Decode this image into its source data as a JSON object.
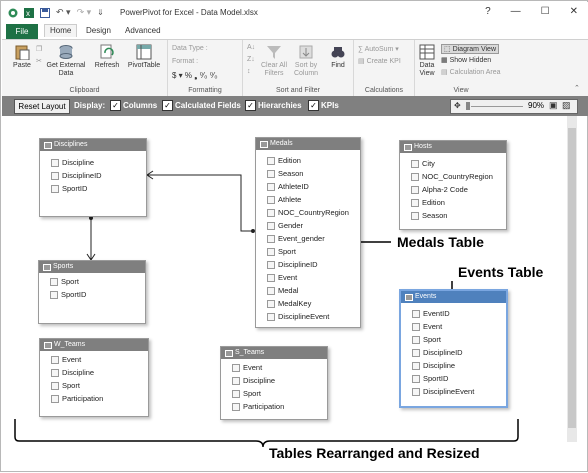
{
  "window": {
    "title": "PowerPivot for Excel - Data Model.xlsx",
    "buttons": [
      "?",
      "—",
      "☐",
      "✕"
    ]
  },
  "tabs": [
    "File",
    "Home",
    "Design",
    "Advanced"
  ],
  "ribbon": {
    "paste": "Paste",
    "get_external": "Get External Data",
    "refresh": "Refresh",
    "pivottable": "PivotTable",
    "data_type": "Data Type :",
    "format": "Format :",
    "currency_row": "$ ▾ % ❟ ⁰⁄₀ ⁰⁄₀",
    "clear_filters": "Clear All Filters",
    "sort_by": "Sort by Column",
    "find": "Find",
    "autosum": "AutoSum ▾",
    "create_kpi": "Create KPI",
    "data_view": "Data View",
    "diagram_view": "Diagram View",
    "show_hidden": "Show Hidden",
    "calc_area": "Calculation Area",
    "groups": [
      "Clipboard",
      "Formatting",
      "Sort and Filter",
      "Calculations",
      "View"
    ]
  },
  "toolbar": {
    "reset": "Reset Layout",
    "display": "Display:",
    "options": [
      "Columns",
      "Calculated Fields",
      "Hierarchies",
      "KPIs"
    ],
    "zoom": "90%"
  },
  "tables": {
    "disciplines": {
      "name": "Disciplines",
      "columns": [
        "Discipline",
        "DisciplineID",
        "SportID"
      ]
    },
    "medals": {
      "name": "Medals",
      "columns": [
        "Edition",
        "Season",
        "AthleteID",
        "Athlete",
        "NOC_CountryRegion",
        "Gender",
        "Event_gender",
        "Sport",
        "DisciplineID",
        "Event",
        "Medal",
        "MedalKey",
        "DisciplineEvent"
      ]
    },
    "hosts": {
      "name": "Hosts",
      "columns": [
        "City",
        "NOC_CountryRegion",
        "Alpha-2 Code",
        "Edition",
        "Season"
      ]
    },
    "sports": {
      "name": "Sports",
      "columns": [
        "Sport",
        "SportID"
      ]
    },
    "events": {
      "name": "Events",
      "columns": [
        "EventID",
        "Event",
        "Sport",
        "DisciplineID",
        "Discipline",
        "SportID",
        "DisciplineEvent"
      ]
    },
    "w_teams": {
      "name": "W_Teams",
      "columns": [
        "Event",
        "Discipline",
        "Sport",
        "Participation"
      ]
    },
    "s_teams": {
      "name": "S_Teams",
      "columns": [
        "Event",
        "Discipline",
        "Sport",
        "Participation"
      ]
    }
  },
  "annotations": {
    "medals": "Medals Table",
    "events": "Events Table",
    "bottom": "Tables Rearranged and Resized"
  }
}
